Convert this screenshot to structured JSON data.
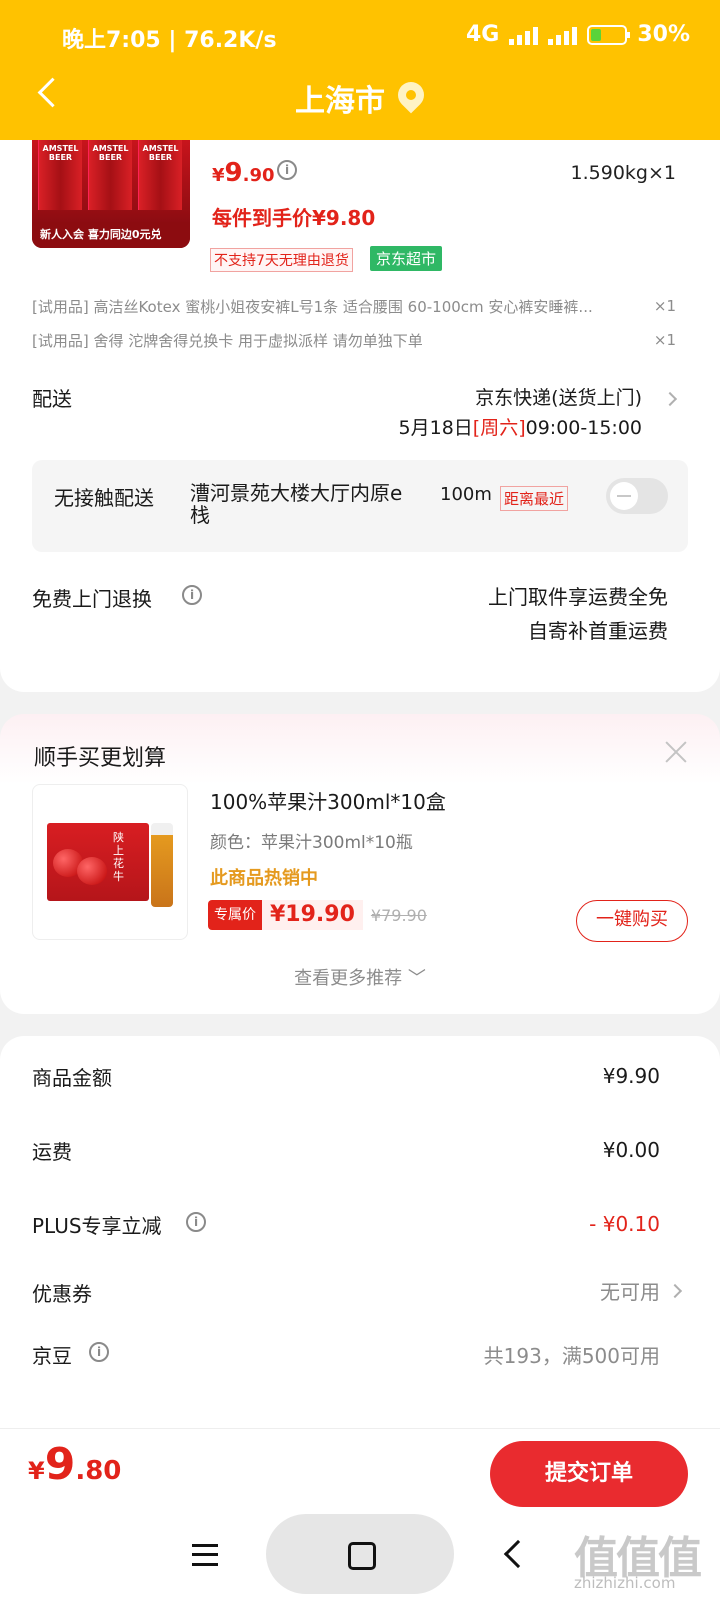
{
  "status": {
    "time": "晚上7:05 | 76.2K/s",
    "network": "4G",
    "battery": "30%"
  },
  "header": {
    "city": "上海市"
  },
  "product": {
    "image_text": "新人入会 喜力同边0元兑",
    "can_label": "AMSTEL BEER",
    "price_currency": "¥",
    "price_int": "9",
    "price_dec": ".90",
    "weight_qty": "1.590kg×1",
    "hand_price": "每件到手价¥9.80",
    "tag_noreturn": "不支持7天无理由退货",
    "tag_jd": "京东超市"
  },
  "trials": [
    {
      "text": "[试用品] 高洁丝Kotex 蜜桃小姐夜安裤L号1条 适合腰围 60-100cm 安心裤安睡裤...",
      "qty": "×1"
    },
    {
      "text": "[试用品] 舍得 沱牌舍得兑换卡 用于虚拟派样 请勿单独下单",
      "qty": "×1"
    }
  ],
  "delivery": {
    "label": "配送",
    "method": "京东快递(送货上门)",
    "date": "5月18日",
    "weekday": "[周六]",
    "time": "09:00-15:00"
  },
  "contactless": {
    "title": "无接触配送",
    "address": "漕河景苑大楼大厅内原e栈",
    "distance": "100m",
    "tag": "距离最近"
  },
  "returns": {
    "label": "免费上门退换",
    "line1": "上门取件享运费全免",
    "line2": "自寄补首重运费"
  },
  "recommend": {
    "title": "顺手买更划算",
    "name": "100%苹果汁300ml*10盒",
    "color": "颜色：苹果汁300ml*10瓶",
    "hot": "此商品热销中",
    "tag": "专属价",
    "price": "¥19.90",
    "old_price": "¥79.90",
    "buy": "一键购买",
    "more": "查看更多推荐",
    "img_text": "陕上花牛"
  },
  "summary": [
    {
      "label": "商品金额",
      "value": "¥9.90"
    },
    {
      "label": "运费",
      "value": "¥0.00"
    },
    {
      "label": "PLUS专享立减",
      "value": "- ¥0.10"
    },
    {
      "label": "优惠券",
      "value": "无可用"
    },
    {
      "label": "京豆",
      "value": "共193，满500可用"
    }
  ],
  "footer": {
    "currency": "¥",
    "total_int": "9",
    "total_dec": ".80",
    "submit": "提交订单"
  },
  "watermark": {
    "logo": "值值值",
    "site": "zhizhizhi.com"
  },
  "colors": {
    "brand": "#ffc200",
    "price": "#e2231a",
    "jd_green": "#2fb865",
    "submit": "#e92b2f"
  },
  "icons": [
    "back-icon",
    "location-pin-icon",
    "info-icon",
    "chevron-right-icon",
    "close-icon",
    "chevron-down-icon",
    "menu-icon",
    "home-icon",
    "nav-back-icon"
  ]
}
